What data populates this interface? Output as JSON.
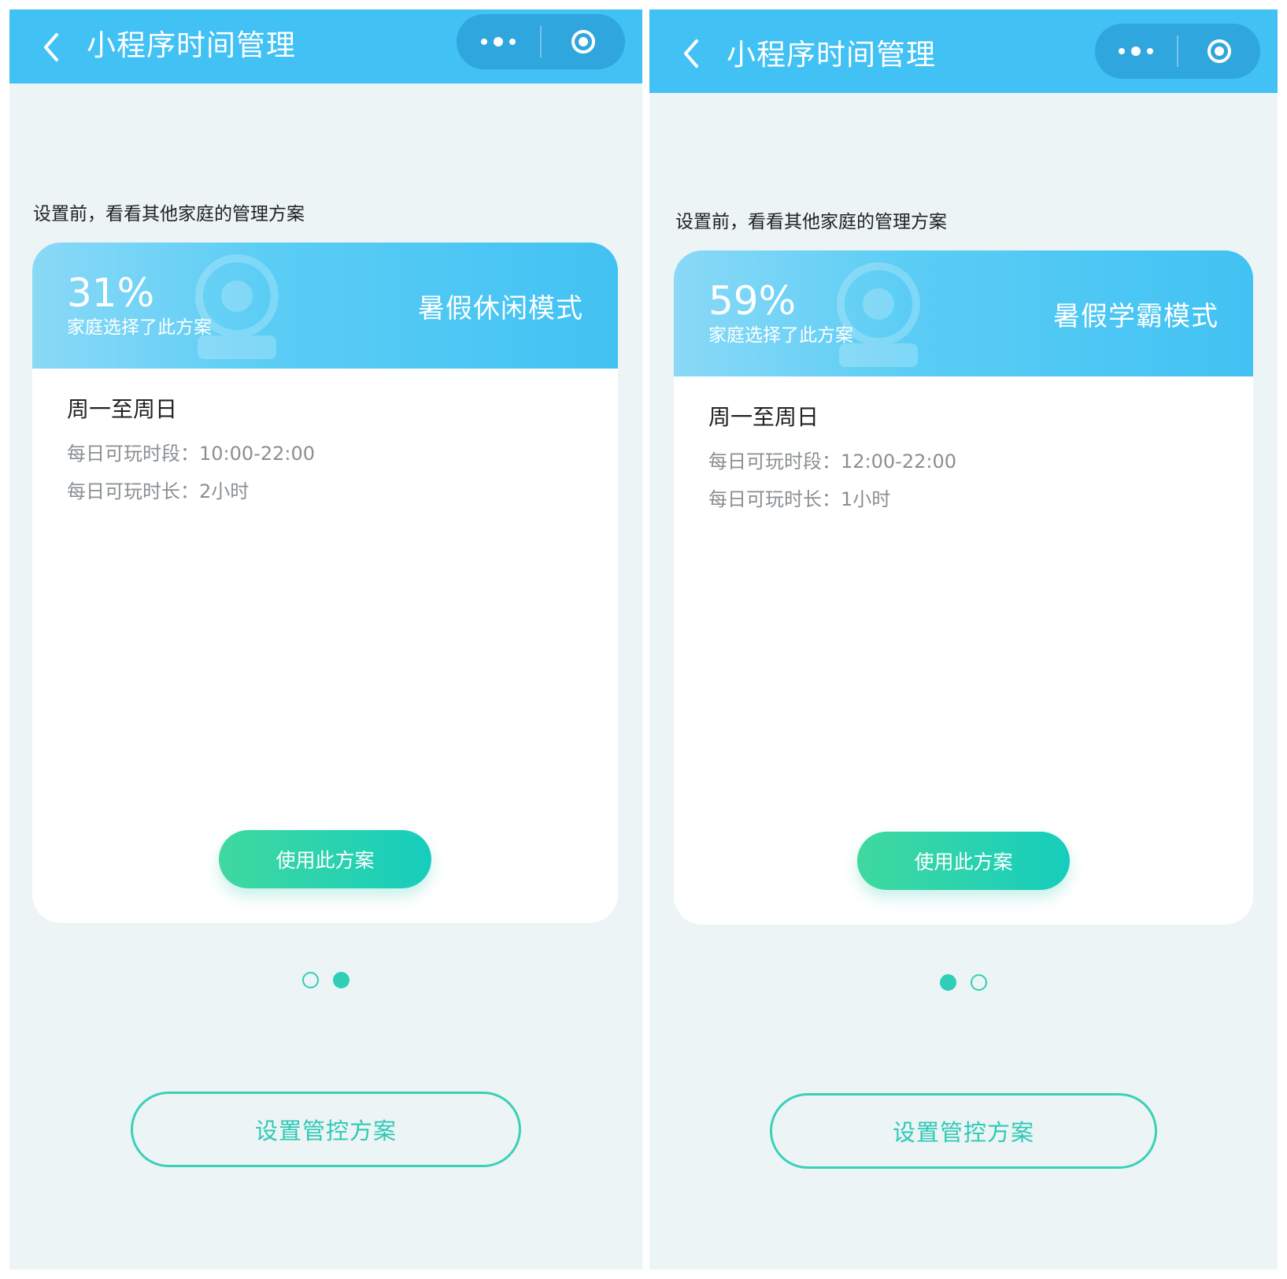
{
  "screens": [
    {
      "nav": {
        "title": "小程序时间管理"
      },
      "hint": "设置前，看看其他家庭的管理方案",
      "card": {
        "percent": "31%",
        "percent_label": "家庭选择了此方案",
        "mode_name": "暑假休闲模式",
        "days": "周一至周日",
        "period": "每日可玩时段：10:00-22:00",
        "duration": "每日可玩时长：2小时",
        "use_button": "使用此方案"
      },
      "pager": {
        "count": 2,
        "active_index": 1
      },
      "setup_button": "设置管控方案"
    },
    {
      "nav": {
        "title": "小程序时间管理"
      },
      "hint": "设置前，看看其他家庭的管理方案",
      "card": {
        "percent": "59%",
        "percent_label": "家庭选择了此方案",
        "mode_name": "暑假学霸模式",
        "days": "周一至周日",
        "period": "每日可玩时段：12:00-22:00",
        "duration": "每日可玩时长：1小时",
        "use_button": "使用此方案"
      },
      "pager": {
        "count": 2,
        "active_index": 0
      },
      "setup_button": "设置管控方案"
    }
  ],
  "icons": {
    "back": "chevron-left-icon",
    "more": "more-dots-icon",
    "close": "target-circle-icon"
  },
  "colors": {
    "nav_bg": "#41c1f4",
    "capsule_bg": "#2fa6dd",
    "page_bg": "#ecf4f5",
    "accent_green": "#2fcfb7",
    "card_header": "#42c2f3"
  }
}
